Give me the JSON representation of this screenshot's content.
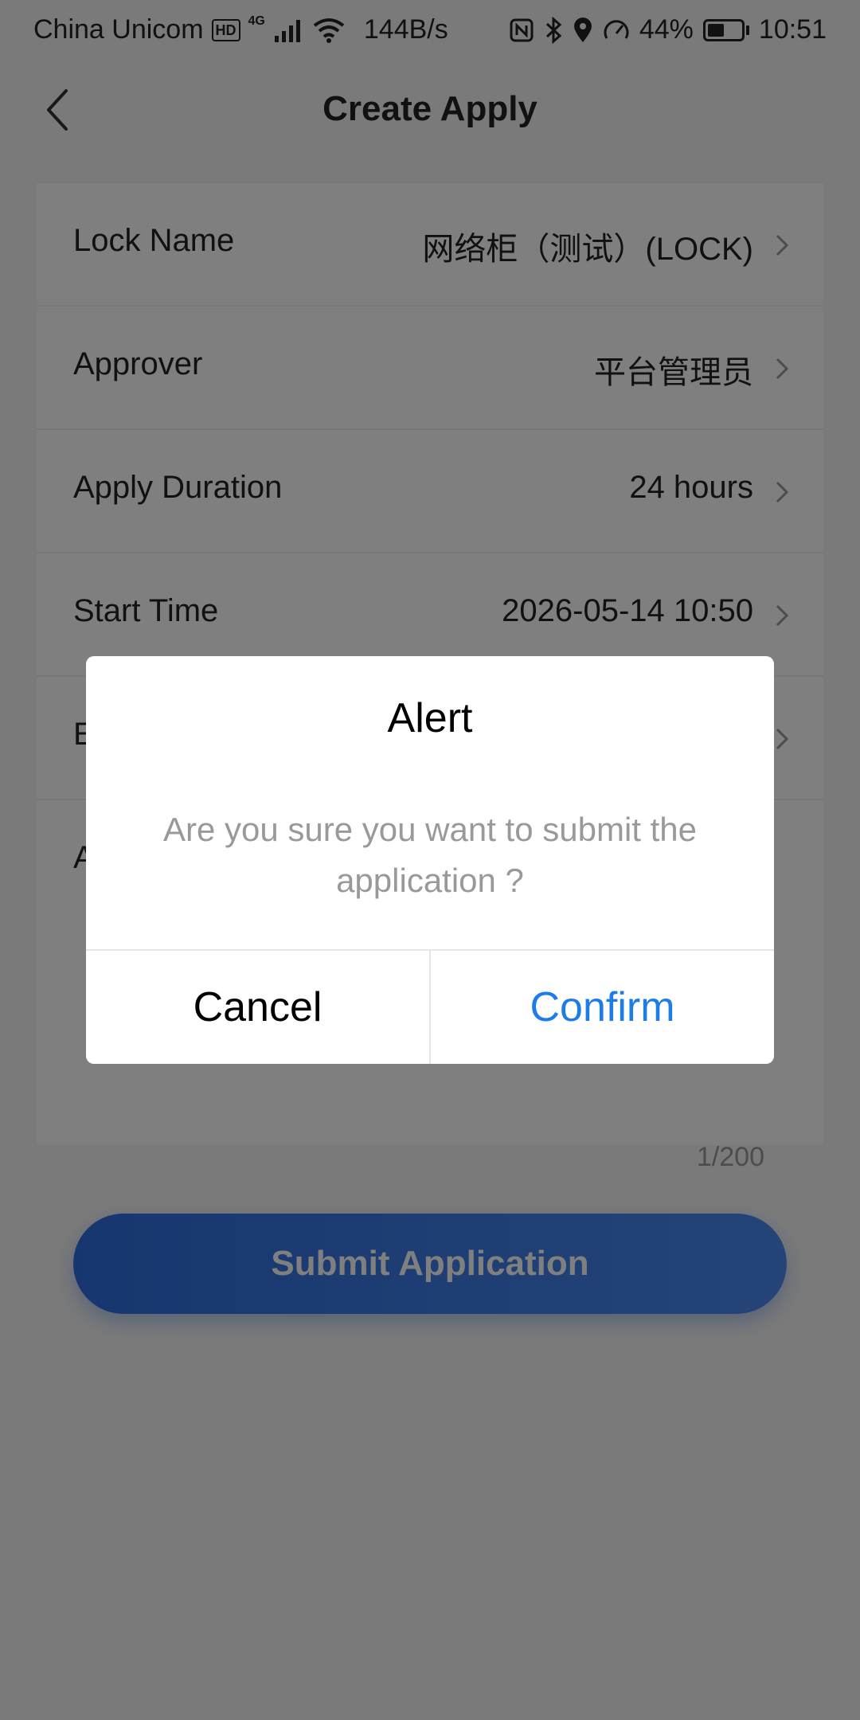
{
  "status_bar": {
    "carrier": "China Unicom",
    "hd_badge": "HD",
    "network_type": "4G",
    "net_speed": "144B/s",
    "battery_percent": "44%",
    "battery_level": 0.44,
    "time": "10:51",
    "icons": [
      "signal-icon",
      "wifi-icon",
      "nfc-icon",
      "bluetooth-icon",
      "location-icon",
      "speedometer-icon",
      "battery-icon"
    ]
  },
  "nav": {
    "title": "Create Apply",
    "back_icon": "chevron-left-icon"
  },
  "form": {
    "rows": [
      {
        "label": "Lock Name",
        "value": "网络柜（测试）(LOCK)"
      },
      {
        "label": "Approver",
        "value": "平台管理员"
      },
      {
        "label": "Apply Duration",
        "value": "24 hours"
      },
      {
        "label": "Start Time",
        "value": "2026-05-14 10:50"
      },
      {
        "label": "E",
        "value": ""
      }
    ],
    "reason_label": "A",
    "char_count": "1/200"
  },
  "submit_button": {
    "label": "Submit Application"
  },
  "dialog": {
    "title": "Alert",
    "message": "Are you sure you want to submit the application ?",
    "cancel_label": "Cancel",
    "confirm_label": "Confirm"
  },
  "colors": {
    "accent": "#1e7ce8",
    "submit_gradient_start": "#2f6de0",
    "submit_gradient_end": "#4a8af0",
    "overlay": "rgba(0,0,0,0.5)"
  }
}
